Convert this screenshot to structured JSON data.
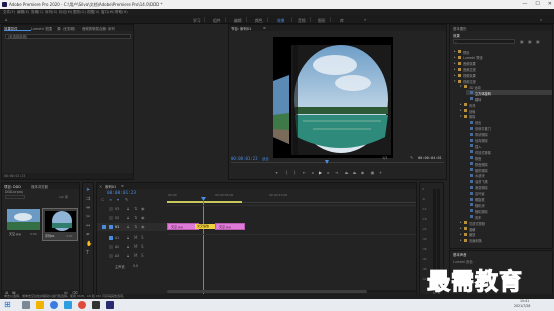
{
  "titlebar": {
    "title": "Adobe Premiere Pro 2020 - C:\\用户\\Silva\\文档\\Adobe\\Premiere Pro\\14.0\\DDD *",
    "min": "—",
    "max": "☐",
    "close": "✕"
  },
  "menu": [
    "文件(F)",
    "编辑(E)",
    "剪辑(C)",
    "序列(S)",
    "标记(M)",
    "图形(G)",
    "视图(V)",
    "窗口(W)",
    "帮助(H)"
  ],
  "workspaces": [
    "学习",
    "组件",
    "编辑",
    "颜色",
    "效果",
    "音频",
    "图形",
    "库"
  ],
  "active_workspace": "效果",
  "source_panel": {
    "tabs": [
      "效果控件",
      "Lumetri 范围",
      "源: (无剪辑)",
      "音频剪辑混合器: 序列"
    ],
    "dropdown": "(未选择剪辑)"
  },
  "program_monitor": {
    "title": "节目: 序列01",
    "timecode_left": "00:00:01:23",
    "fit": "适合",
    "resolution": "1/2",
    "timecode_right": "00:00:04:01"
  },
  "project_panel": {
    "tabs": [
      "项目: DDD",
      "媒体浏览器"
    ],
    "filename": "DDD.prproj",
    "items_count": "1/2 项",
    "clips": [
      {
        "name": "天空.jpg",
        "duration": "5:00"
      },
      {
        "name": "序列01",
        "duration": "4:01"
      }
    ]
  },
  "timeline": {
    "tab": "序列01",
    "timecode": "00:00:01:23",
    "ruler": [
      "00:00",
      "00:00:05:00",
      "00:00:10:00"
    ],
    "tracks_video": [
      "V3",
      "V2",
      "V1"
    ],
    "tracks_audio": [
      "A1",
      "A2",
      "A3"
    ],
    "master": "主声道",
    "master_value": "0.0",
    "clip1": "天空.jpg",
    "clip2": "天空.jpg",
    "transition": "交叉缩放",
    "meters": [
      "0",
      "-6",
      "-12",
      "-18",
      "-24",
      "-30",
      "-36",
      "-42",
      "-48",
      "-54"
    ],
    "meter_labels": [
      "S",
      "S"
    ]
  },
  "effects_panel": {
    "tabs": [
      "基本图形",
      "效果"
    ],
    "search_placeholder": "",
    "items": [
      {
        "label": "预设",
        "level": 0,
        "folder": true
      },
      {
        "label": "Lumetri 预设",
        "level": 0,
        "folder": true
      },
      {
        "label": "音频效果",
        "level": 0,
        "folder": true
      },
      {
        "label": "音频过渡",
        "level": 0,
        "folder": true
      },
      {
        "label": "视频效果",
        "level": 0,
        "folder": true
      },
      {
        "label": "视频过渡",
        "level": 0,
        "folder": true,
        "open": true
      },
      {
        "label": "3D 运动",
        "level": 1,
        "folder": true,
        "open": true
      },
      {
        "label": "立方体旋转",
        "level": 2,
        "folder": false,
        "selected": true
      },
      {
        "label": "翻转",
        "level": 2,
        "folder": false
      },
      {
        "label": "内滑",
        "level": 1,
        "folder": true
      },
      {
        "label": "划像",
        "level": 1,
        "folder": true
      },
      {
        "label": "擦除",
        "level": 1,
        "folder": true,
        "open": true
      },
      {
        "label": "划出",
        "level": 2,
        "folder": false
      },
      {
        "label": "双侧平推门",
        "level": 2,
        "folder": false
      },
      {
        "label": "带状擦除",
        "level": 2,
        "folder": false
      },
      {
        "label": "径向擦除",
        "level": 2,
        "folder": false
      },
      {
        "label": "插入",
        "level": 2,
        "folder": false
      },
      {
        "label": "时钟式擦除",
        "level": 2,
        "folder": false
      },
      {
        "label": "棋盘",
        "level": 2,
        "folder": false
      },
      {
        "label": "棋盘擦除",
        "level": 2,
        "folder": false
      },
      {
        "label": "楔形擦除",
        "level": 2,
        "folder": false
      },
      {
        "label": "水波块",
        "level": 2,
        "folder": false
      },
      {
        "label": "油漆飞溅",
        "level": 2,
        "folder": false
      },
      {
        "label": "渐变擦除",
        "level": 2,
        "folder": false
      },
      {
        "label": "百叶窗",
        "level": 2,
        "folder": false
      },
      {
        "label": "螺旋框",
        "level": 2,
        "folder": false
      },
      {
        "label": "随机块",
        "level": 2,
        "folder": false
      },
      {
        "label": "随机擦除",
        "level": 2,
        "folder": false
      },
      {
        "label": "风车",
        "level": 2,
        "folder": false
      },
      {
        "label": "沉浸式视频",
        "level": 1,
        "folder": true
      },
      {
        "label": "溶解",
        "level": 1,
        "folder": true
      },
      {
        "label": "缩放",
        "level": 1,
        "folder": true
      },
      {
        "label": "页面剥落",
        "level": 1,
        "folder": true
      }
    ],
    "bottom_title": "基本声音",
    "bottom_sub": "Lumetri 颜色"
  },
  "statusbar": "单击以选择，或单击空白处并拖动以进行框选择。使用 Shift、Alt 和 Ctrl 可获得其他选项。",
  "watermark": "最需教育",
  "taskbar": {
    "time": "15:41",
    "date": "2021/7/28"
  },
  "colors": {
    "accent": "#4a8de0",
    "clip": "#e07ad8",
    "transition": "#f0d040",
    "bg": "#232323"
  }
}
